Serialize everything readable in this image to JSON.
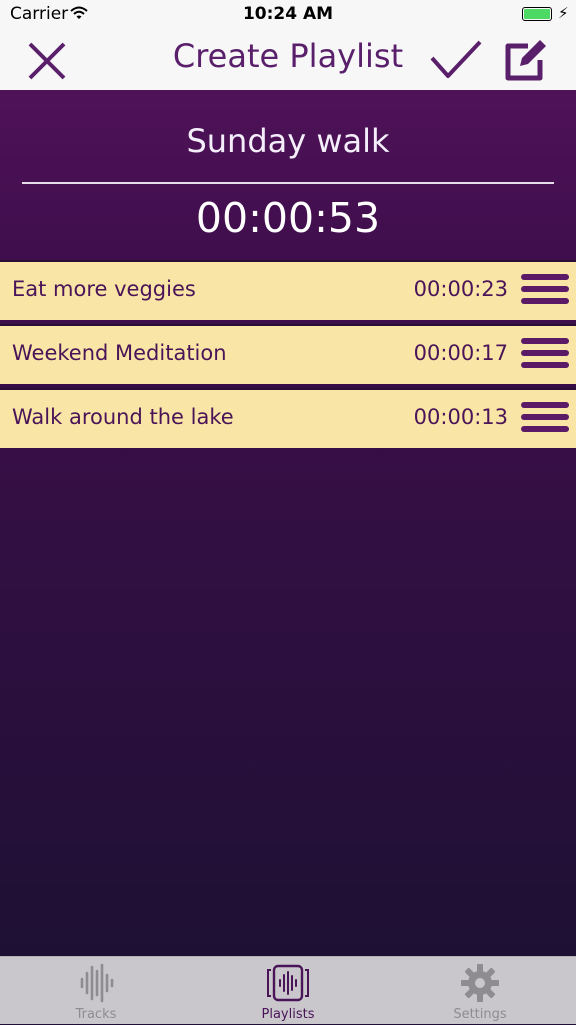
{
  "status_bar": {
    "carrier": "Carrier",
    "time": "10:24 AM",
    "battery_level": 1.0
  },
  "nav_bar": {
    "title": "Create Playlist",
    "close_icon": "close-icon",
    "confirm_icon": "checkmark-icon",
    "edit_icon": "edit-icon"
  },
  "playlist": {
    "name": "Sunday walk",
    "total_duration": "00:00:53"
  },
  "tracks": [
    {
      "title": "Eat more veggies",
      "duration": "00:00:23"
    },
    {
      "title": "Weekend Meditation",
      "duration": "00:00:17"
    },
    {
      "title": "Walk around the lake",
      "duration": "00:00:13"
    }
  ],
  "tab_bar": {
    "items": [
      {
        "label": "Tracks",
        "icon": "waveform-icon",
        "selected": false
      },
      {
        "label": "Playlists",
        "icon": "playlist-icon",
        "selected": true
      },
      {
        "label": "Settings",
        "icon": "gear-icon",
        "selected": false
      }
    ]
  },
  "colors": {
    "accent": "#5a1f6b",
    "header_bg": "#4f1258",
    "row_bg": "#f9e6a6",
    "tab_inactive": "#8e8c91",
    "tab_active": "#4a1458"
  }
}
